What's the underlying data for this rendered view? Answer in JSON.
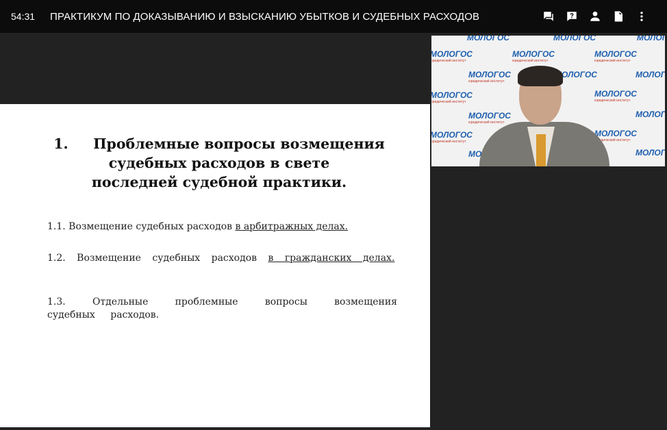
{
  "header": {
    "timer": "54:31",
    "title": "ПРАКТИКУМ ПО ДОКАЗЫВАНИЮ И ВЗЫСКАНИЮ УБЫТКОВ И СУДЕБНЫХ РАСХОДОВ",
    "icons": [
      "chat-icon",
      "question-icon",
      "person-icon",
      "document-icon",
      "more-vert-icon"
    ]
  },
  "slide": {
    "heading_number": "1.",
    "heading_line1": "Проблемные вопросы возмещения",
    "heading_rest": "судебных расходов в свете последней судебной практики.",
    "items": [
      {
        "prefix": "1.1. Возмещение судебных расходов",
        "underlined": "в арбитражных делах."
      },
      {
        "prefix": "1.2. Возмещение судебных расходов",
        "underlined": "в гражданских делах."
      },
      {
        "prefix": "1.3. Отдельные проблемные вопросы возмещения судебных расходов.",
        "underlined": ""
      }
    ]
  },
  "video": {
    "watermark": "МОЛОГОС",
    "watermark_sub": "юридический институт"
  }
}
